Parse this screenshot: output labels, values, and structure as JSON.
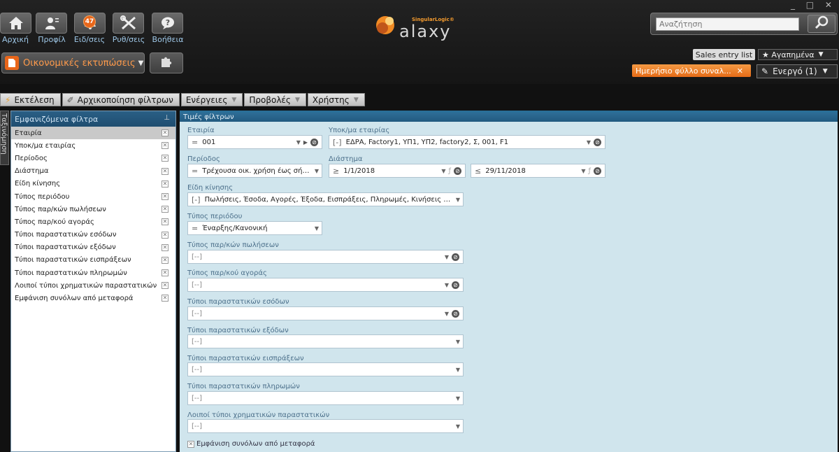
{
  "header": {
    "tiles": [
      {
        "label": "Αρχική",
        "icon": "home-icon"
      },
      {
        "label": "Προφίλ",
        "icon": "profile-icon"
      },
      {
        "label": "Ειδ/σεις",
        "icon": "notifications-icon"
      },
      {
        "label": "Ρυθ/σεις",
        "icon": "settings-tools-icon"
      },
      {
        "label": "Βοήθεια",
        "icon": "help-icon"
      }
    ],
    "notifications_count": "47",
    "module": "Οικονομικές εκτυπώσεις",
    "logo_brand": "SingularLogic®",
    "logo_name": "alaxy",
    "window_controls": "_ □ ✕",
    "search_placeholder": "Αναζήτηση",
    "tab_sales": "Sales entry list",
    "favorites": "★ Αγαπημένα",
    "daily_tab": "Ημερήσιο φύλλο συναλ...",
    "active": "Ενεργό (1)"
  },
  "toolbar": {
    "run": "Εκτέλεση",
    "reset": "Αρχικοποίηση φίλτρων",
    "actions": "Ενέργειες",
    "views": "Προβολές",
    "user": "Χρήστης"
  },
  "side_tab": "Ταξινόμηση",
  "left_panel": {
    "title": "Εμφανιζόμενα φίλτρα",
    "items": [
      "Εταιρία",
      "Υποκ/μα εταιρίας",
      "Περίοδος",
      "Διάστημα",
      "Είδη κίνησης",
      "Τύπος περιόδου",
      "Τύπος παρ/κών πωλήσεων",
      "Τύπος παρ/κού αγοράς",
      "Τύποι παραστατικών εσόδων",
      "Τύποι παραστατικών εξόδων",
      "Τύποι παραστατικών εισπράξεων",
      "Τύποι παραστατικών πληρωμών",
      "Λοιποί τύποι χρηματικών παραστατικών",
      "Εμφάνιση συνόλων από μεταφορά"
    ]
  },
  "right_panel": {
    "title": "Τιμές φίλτρων",
    "company_label": "Εταιρία",
    "company_value": "001",
    "branch_label": "Υποκ/μα εταιρίας",
    "branch_value": "ΕΔΡΑ, Factory1, ΥΠ1, ΥΠ2, factory2, Σ, 001, F1",
    "period_label": "Περίοδος",
    "period_value": "Τρέχουσα οικ. χρήση έως σήμ...",
    "interval_label": "Διάστημα",
    "date_from": "1/1/2018",
    "date_to": "29/11/2018",
    "movement_label": "Είδη κίνησης",
    "movement_value": "Πωλήσεις, Έσοδα, Αγορές, Έξοδα, Εισπράξεις, Πληρωμές, Κινήσεις λοιπώ...",
    "period_type_label": "Τύπος περιόδου",
    "period_type_value": "Έναρξης/Κανονική",
    "sales_doc_label": "Τύπος παρ/κών πωλήσεων",
    "purchase_doc_label": "Τύπος παρ/κού αγοράς",
    "income_label": "Τύποι παραστατικών εσόδων",
    "expense_label": "Τύποι παραστατικών εξόδων",
    "receipts_label": "Τύποι παραστατικών εισπράξεων",
    "payments_label": "Τύποι παραστατικών πληρωμών",
    "other_label": "Λοιποί τύποι χρηματικών παραστατικών",
    "empty_value": "[--]",
    "show_totals": "Εμφάνιση συνόλων από μεταφορά"
  }
}
